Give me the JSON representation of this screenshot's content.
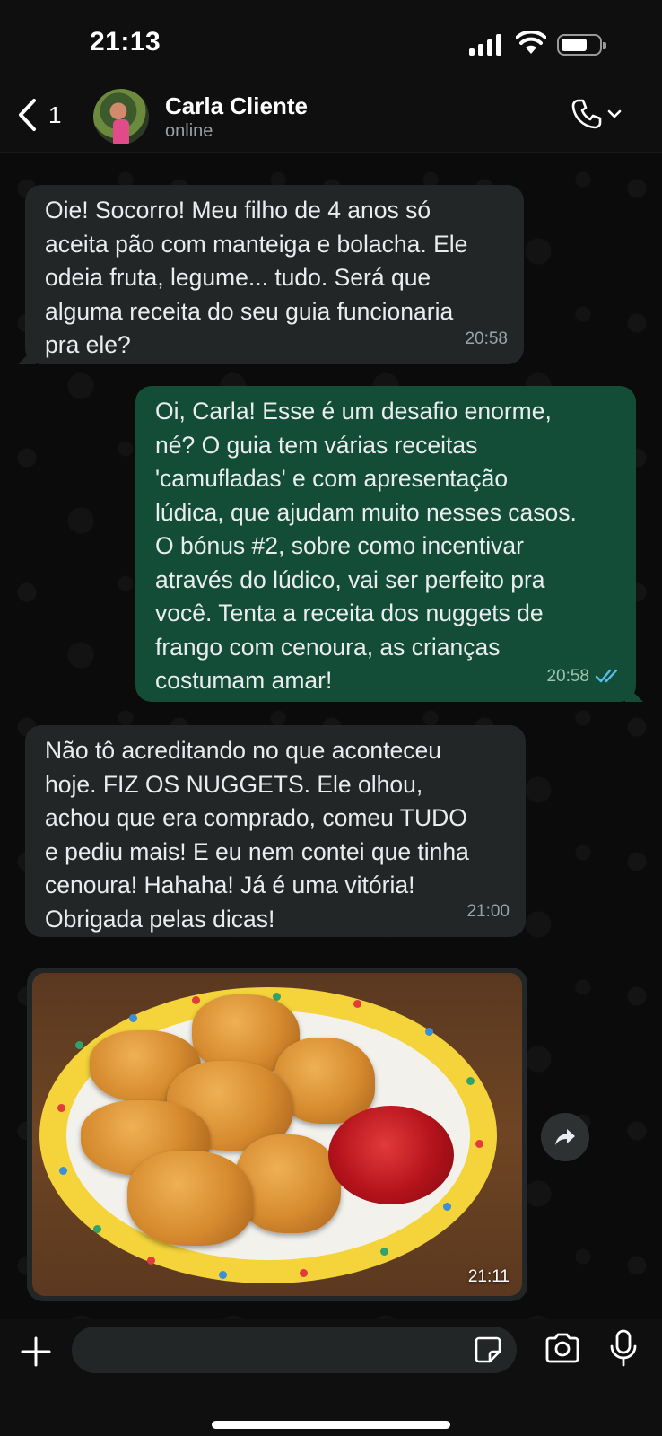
{
  "status_bar": {
    "time": "21:13"
  },
  "header": {
    "back_count": "1",
    "contact_name": "Carla Cliente",
    "contact_status": "online"
  },
  "messages": [
    {
      "direction": "incoming",
      "text": "Oie! Socorro! Meu filho de 4 anos só\naceita pão com manteiga e bolacha. Ele\nodeia fruta, legume... tudo. Será que\nalguma receita do seu guia funcionaria\npra ele?",
      "time": "20:58"
    },
    {
      "direction": "outgoing",
      "text": "Oi, Carla! Esse é um desafio enorme,\nné? O guia tem várias receitas\n'camufladas' e com apresentação\nlúdica, que ajudam muito nesses casos.\nO bónus #2, sobre como incentivar\natravés do lúdico, vai ser perfeito pra\nvocê. Tenta a receita dos nuggets de\nfrango com cenoura, as crianças\ncostumam amar!",
      "time": "20:58",
      "read_receipt": "double-check-read-icon"
    },
    {
      "direction": "incoming",
      "text": "Não tô acreditando no que aconteceu\nhoje. FIZ OS NUGGETS. Ele olhou,\nachou que era comprado, comeu TUDO\ne pediu mais! E eu nem contei que tinha\ncenoura! Hahaha! Já é uma vitória!\nObrigada pelas dicas!",
      "time": "21:00"
    },
    {
      "direction": "incoming",
      "type": "image",
      "time": "21:11"
    }
  ],
  "input": {
    "placeholder": "",
    "value": ""
  },
  "colors": {
    "incoming_bubble": "#232626",
    "outgoing_bubble": "#144d37",
    "read_tick": "#53bdeb",
    "background": "#0b0b0b"
  }
}
